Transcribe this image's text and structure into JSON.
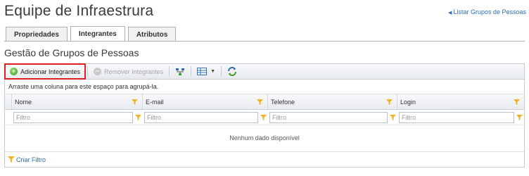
{
  "header": {
    "title": "Equipe de Infraestrura",
    "back_link": "Listar Grupos de Pessoas"
  },
  "tabs": [
    {
      "label": "Propriedades",
      "active": false
    },
    {
      "label": "Integrantes",
      "active": true
    },
    {
      "label": "Atributos",
      "active": false
    }
  ],
  "section": {
    "title": "Gestão de Grupos de Pessoas"
  },
  "toolbar": {
    "add_label": "Adicionar Integrantes",
    "remove_label": "Remover Integrantes",
    "remove_enabled": false
  },
  "grid": {
    "group_hint": "Arraste uma coluna para este espaço para agrupá-la.",
    "columns": [
      {
        "label": "Nome",
        "filter_placeholder": "Filtro"
      },
      {
        "label": "E-mail",
        "filter_placeholder": "Filtro"
      },
      {
        "label": "Telefone",
        "filter_placeholder": "Filtro"
      },
      {
        "label": "Login",
        "filter_placeholder": "Filtro"
      }
    ],
    "empty_message": "Nenhum dado disponível",
    "create_filter_label": "Criar Filtro"
  },
  "colors": {
    "link": "#2f6fb7",
    "highlight": "#e02020",
    "filter_icon": "#f0b429",
    "add_icon": "#3e9f28"
  },
  "icons": [
    "plus-circle-icon",
    "minus-circle-icon",
    "hierarchy-icon",
    "columns-icon",
    "refresh-icon",
    "filter-icon",
    "back-arrow-icon"
  ]
}
